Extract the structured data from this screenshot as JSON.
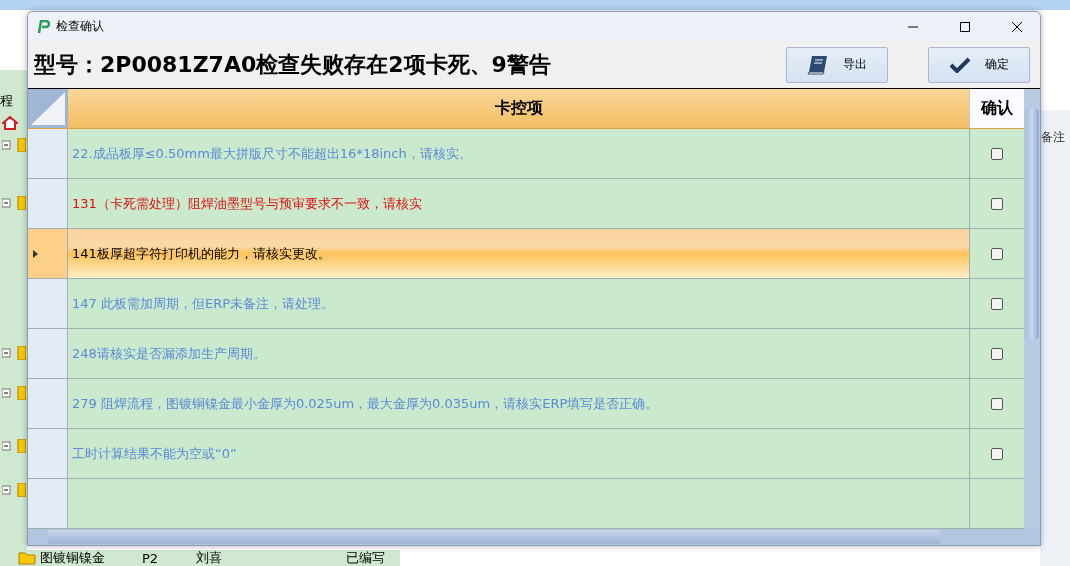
{
  "background": {
    "tree_label": "程",
    "column_header": "备注",
    "bottom_row": [
      "图镀铜镍金",
      "P2",
      "刘喜",
      "已编写"
    ]
  },
  "dialog": {
    "title": "检查确认",
    "heading": "型号：2P0081Z7A0检查失败存在2项卡死、9警告",
    "buttons": [
      {
        "label": "导出",
        "kind": "export"
      },
      {
        "label": "确定",
        "kind": "confirm"
      }
    ],
    "table": {
      "columns": [
        "卡控项",
        "确认"
      ],
      "rows": [
        {
          "text": "22.成品板厚≤0.50mm最大拼版尺寸不能超出16*18inch，请核实。",
          "kind": "warning",
          "selected": false,
          "checked": false
        },
        {
          "text": "131（卡死需处理）阻焊油墨型号与预审要求不一致，请核实",
          "kind": "blocking",
          "selected": false,
          "checked": false
        },
        {
          "text": "141板厚超字符打印机的能力，请核实更改。",
          "kind": "warning",
          "selected": true,
          "checked": false
        },
        {
          "text": "147 此板需加周期，但ERP未备注，请处理。",
          "kind": "warning",
          "selected": false,
          "checked": false
        },
        {
          "text": "248请核实是否漏添加生产周期。",
          "kind": "warning",
          "selected": false,
          "checked": false
        },
        {
          "text": "279 阻焊流程，图镀铜镍金最小金厚为0.025um，最大金厚为0.035um，请核实ERP填写是否正确。",
          "kind": "warning",
          "selected": false,
          "checked": false
        },
        {
          "text": "工时计算结果不能为空或“0”",
          "kind": "warning",
          "selected": false,
          "checked": false
        }
      ]
    }
  }
}
